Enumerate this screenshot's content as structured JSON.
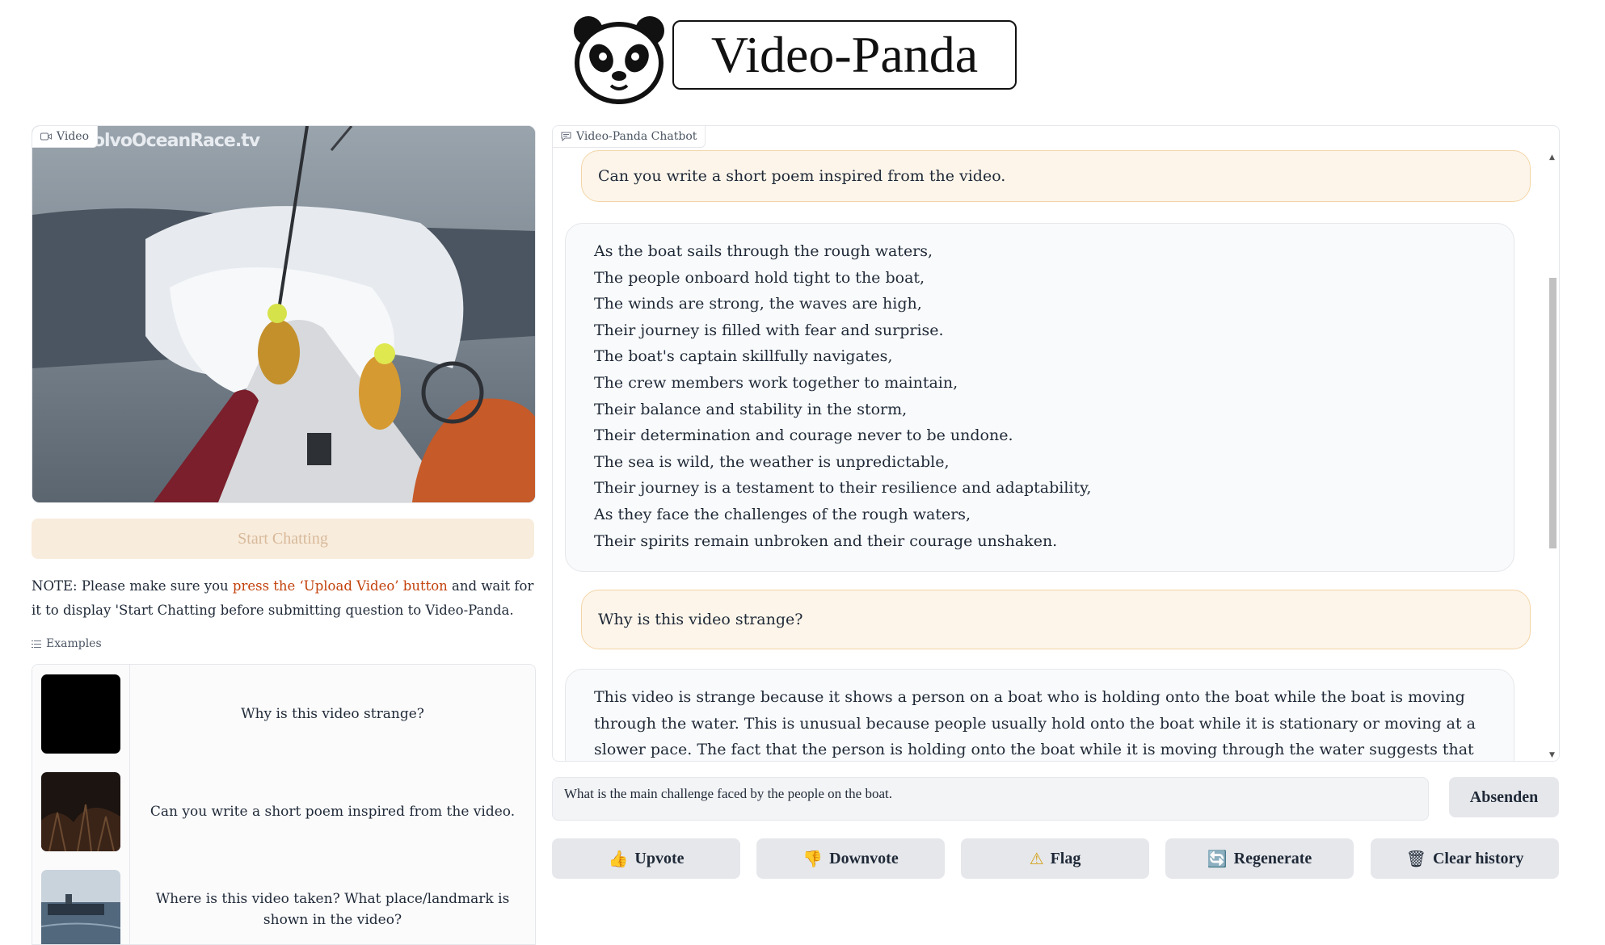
{
  "header": {
    "title": "Video-Panda",
    "logo_icon": "panda-logo-icon"
  },
  "video_panel": {
    "label": "Video",
    "watermark": "VolvoOceanRace.tv"
  },
  "start_button": {
    "label": "Start Chatting"
  },
  "note": {
    "prefix": "NOTE: Please make sure you ",
    "highlight": "press the ‘Upload Video’ button",
    "suffix": " and wait for it to display 'Start Chatting before submitting question to Video-Panda."
  },
  "examples": {
    "label": "Examples",
    "items": [
      {
        "text": "Why is this video strange?"
      },
      {
        "text": "Can you write a short poem inspired from the video."
      },
      {
        "text": "Where is this video taken? What place/landmark is shown in the video?"
      }
    ]
  },
  "chatbot": {
    "label": "Video-Panda Chatbot",
    "messages": [
      {
        "role": "user",
        "text": "Can you write a short poem inspired from the video."
      },
      {
        "role": "bot",
        "lines": [
          "As the boat sails through the rough waters,",
          "The people onboard hold tight to the boat,",
          "The winds are strong, the waves are high,",
          "Their journey is filled with fear and surprise.",
          "The boat's captain skillfully navigates,",
          "The crew members work together to maintain,",
          "Their balance and stability in the storm,",
          "Their determination and courage never to be undone.",
          "The sea is wild, the weather is unpredictable,",
          "Their journey is a testament to their resilience and adaptability,",
          "As they face the challenges of the rough waters,",
          "Their spirits remain unbroken and their courage unshaken."
        ]
      },
      {
        "role": "user",
        "text": "Why is this video strange?"
      },
      {
        "role": "bot",
        "text": "This video is strange because it shows a person on a boat who is holding onto the boat while the boat is moving through the water. This is unusual because people usually hold onto the boat while it is stationary or moving at a slower pace. The fact that the person is holding onto the boat while it is moving through the water suggests that the boat is experiencing rough"
      }
    ]
  },
  "input": {
    "value": "What is the main challenge faced by the people on the boat."
  },
  "send_button": {
    "label": "Absenden"
  },
  "actions": {
    "upvote": "Upvote",
    "downvote": "Downvote",
    "flag": "Flag",
    "regenerate": "Regenerate",
    "clear": "Clear history"
  },
  "colors": {
    "accent_highlight": "#c2410c",
    "user_bubble": "#fdf5ea",
    "start_button_bg": "#f8ecdc"
  }
}
